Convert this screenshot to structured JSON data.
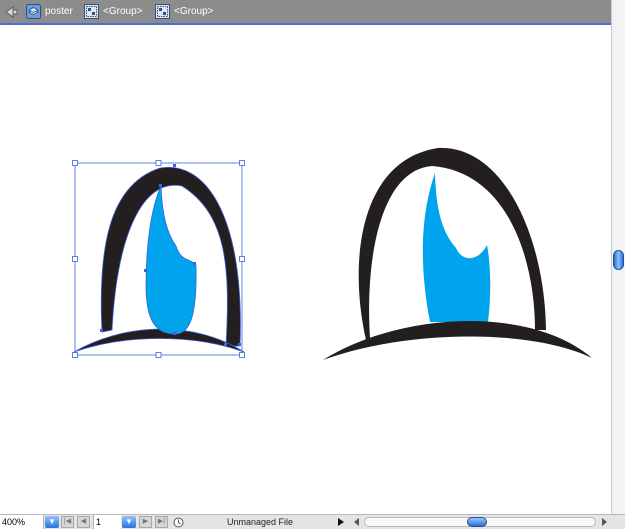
{
  "breadcrumb": {
    "items": [
      {
        "label": "poster",
        "icon": "layer-stack-icon"
      },
      {
        "label": "<Group>",
        "icon": "group-icon"
      },
      {
        "label": "<Group>",
        "icon": "group-icon"
      }
    ]
  },
  "status_bar": {
    "zoom": "400%",
    "page": "1",
    "status_text": "Unmanaged File"
  },
  "colors": {
    "eye_outline": "#231f20",
    "iris": "#00a4ec",
    "selection": "#3d63d6",
    "accent": "#2b73d8"
  }
}
